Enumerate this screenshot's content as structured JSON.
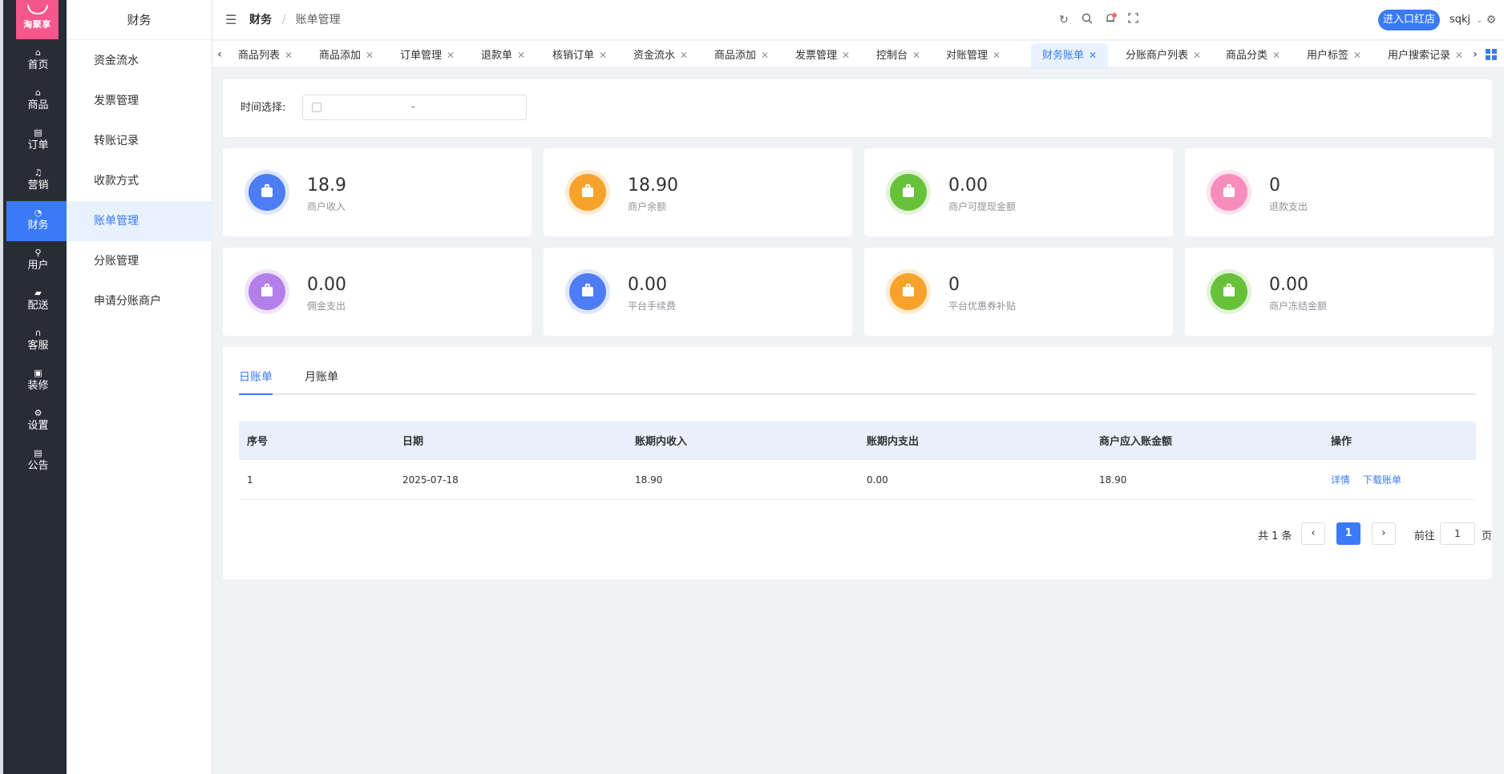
{
  "logo_text": "淘聚享",
  "rail": [
    {
      "label": "首页",
      "icon": "home-icon"
    },
    {
      "label": "商品",
      "icon": "bag-icon"
    },
    {
      "label": "订单",
      "icon": "document-icon"
    },
    {
      "label": "营销",
      "icon": "bell-icon"
    },
    {
      "label": "财务",
      "icon": "pie-chart-icon",
      "active": true
    },
    {
      "label": "用户",
      "icon": "user-icon"
    },
    {
      "label": "配送",
      "icon": "truck-icon"
    },
    {
      "label": "客服",
      "icon": "headset-icon"
    },
    {
      "label": "装修",
      "icon": "brush-icon"
    },
    {
      "label": "设置",
      "icon": "gear-icon"
    },
    {
      "label": "公告",
      "icon": "notice-icon"
    }
  ],
  "subnav": {
    "title": "财务",
    "items": [
      "资金流水",
      "发票管理",
      "转账记录",
      "收款方式",
      "账单管理",
      "分账管理",
      "申请分账商户"
    ],
    "active": "账单管理"
  },
  "header": {
    "breadcrumb_parent": "财务",
    "breadcrumb_separator": "/",
    "breadcrumb_current": "账单管理",
    "store_button": "进入口红店",
    "username": "sqkj"
  },
  "tabs": [
    {
      "label": "商品列表"
    },
    {
      "label": "商品添加"
    },
    {
      "label": "订单管理"
    },
    {
      "label": "退款单"
    },
    {
      "label": "核销订单"
    },
    {
      "label": "资金流水"
    },
    {
      "label": "商品添加"
    },
    {
      "label": "发票管理"
    },
    {
      "label": "控制台"
    },
    {
      "label": "对账管理"
    },
    {
      "label": "财务账单",
      "active": true
    },
    {
      "label": "分账商户列表"
    },
    {
      "label": "商品分类"
    },
    {
      "label": "用户标签"
    },
    {
      "label": "用户搜索记录"
    }
  ],
  "filter": {
    "label": "时间选择:",
    "range_separator": "-"
  },
  "stats": [
    {
      "value": "18.9",
      "label": "商户收入",
      "color": "#4d7cf4",
      "ring": "#dfe7fd"
    },
    {
      "value": "18.90",
      "label": "商户余额",
      "color": "#f7a22b",
      "ring": "#fdebd2"
    },
    {
      "value": "0.00",
      "label": "商户可提现金额",
      "color": "#67c23a",
      "ring": "#e2f3d9"
    },
    {
      "value": "0",
      "label": "退款支出",
      "color": "#f78dbd",
      "ring": "#fde3ee"
    },
    {
      "value": "0.00",
      "label": "佣金支出",
      "color": "#b37feb",
      "ring": "#efe3fb"
    },
    {
      "value": "0.00",
      "label": "平台手续费",
      "color": "#4d7cf4",
      "ring": "#dfe7fd"
    },
    {
      "value": "0",
      "label": "平台优惠券补贴",
      "color": "#f7a22b",
      "ring": "#fdebd2"
    },
    {
      "value": "0.00",
      "label": "商户冻结金额",
      "color": "#67c23a",
      "ring": "#e2f3d9"
    }
  ],
  "bill_tabs": [
    "日账单",
    "月账单"
  ],
  "table": {
    "columns": [
      "序号",
      "日期",
      "账期内收入",
      "账期内支出",
      "商户应入账金额",
      "操作"
    ],
    "rows": [
      {
        "index": "1",
        "date": "2025-07-18",
        "income": "18.90",
        "expense": "0.00",
        "amount": "18.90",
        "actions": [
          "详情",
          "下载账单"
        ]
      }
    ]
  },
  "pagination": {
    "total": "共 1 条",
    "prev": "‹",
    "next": "›",
    "current": "1",
    "goto_label": "前往",
    "goto_value": "1",
    "goto_unit": "页"
  }
}
